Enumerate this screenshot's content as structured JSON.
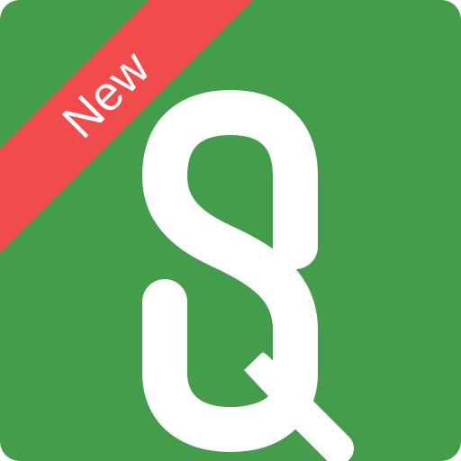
{
  "app_icon": {
    "background_color": "#449d4b",
    "logo_color": "#ffffff",
    "logo_icon": "stylized-sq-monogram-icon"
  },
  "badge": {
    "label": "New",
    "background_color": "#f24b4b",
    "text_color": "#ffffff"
  }
}
